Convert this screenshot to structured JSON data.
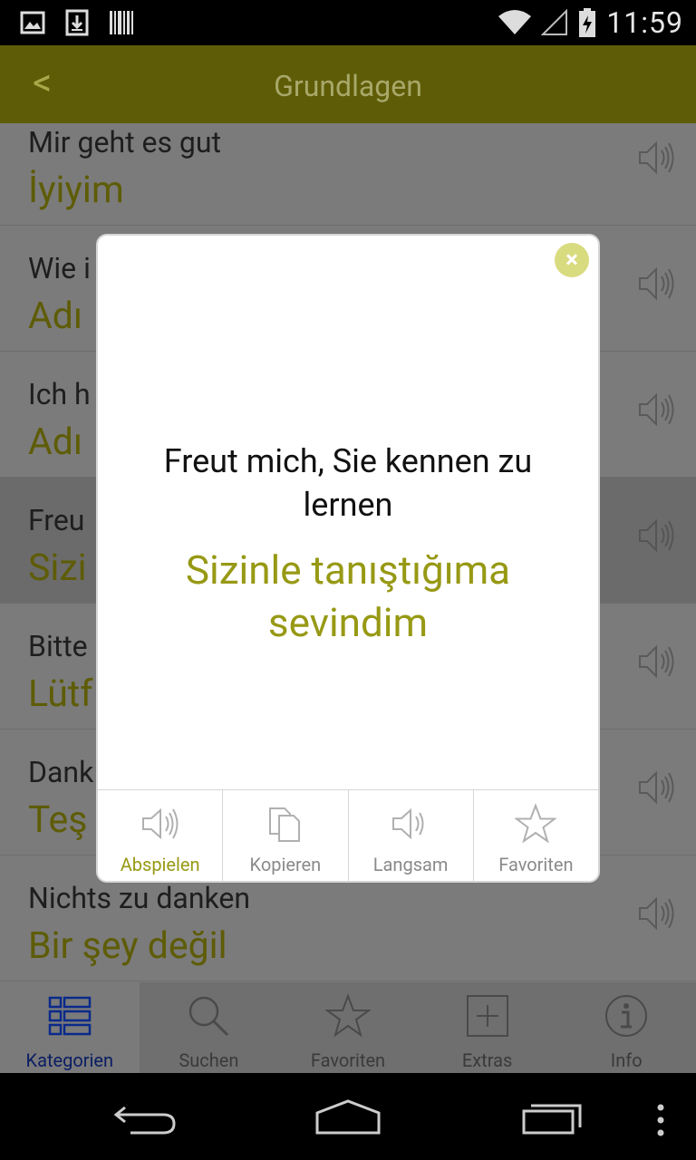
{
  "status_bar": {
    "time": "11:59"
  },
  "app_bar": {
    "back_label": "<",
    "title": "Grundlagen"
  },
  "list": {
    "rows": [
      {
        "german": "Mir geht es gut",
        "turkish": "İyiyim"
      },
      {
        "german": "Wie i",
        "turkish": "Adı"
      },
      {
        "german": "Ich h",
        "turkish": "Adı"
      },
      {
        "german": "Freu",
        "turkish": "Sizi"
      },
      {
        "german": "Bitte",
        "turkish": "Lütf"
      },
      {
        "german": "Dank",
        "turkish": "Teş"
      },
      {
        "german": "Nichts zu danken",
        "turkish": "Bir şey değil"
      }
    ]
  },
  "dialog": {
    "german": "Freut mich, Sie kennen zu lernen",
    "turkish": "Sizinle tanıştığıma sevindim",
    "close_label": "×",
    "actions": [
      {
        "label": "Abspielen",
        "icon": "speaker-icon"
      },
      {
        "label": "Kopieren",
        "icon": "copy-icon"
      },
      {
        "label": "Langsam",
        "icon": "speaker-icon"
      },
      {
        "label": "Favoriten",
        "icon": "star-icon"
      }
    ]
  },
  "tab_bar": {
    "tabs": [
      {
        "label": "Kategorien",
        "icon": "list-icon"
      },
      {
        "label": "Suchen",
        "icon": "search-icon"
      },
      {
        "label": "Favoriten",
        "icon": "star-icon"
      },
      {
        "label": "Extras",
        "icon": "plus-icon"
      },
      {
        "label": "Info",
        "icon": "info-icon"
      }
    ]
  },
  "colors": {
    "accent": "#979914",
    "app_bar_dimmed": "#5e5c06",
    "active_tab": "#0a1d63"
  }
}
